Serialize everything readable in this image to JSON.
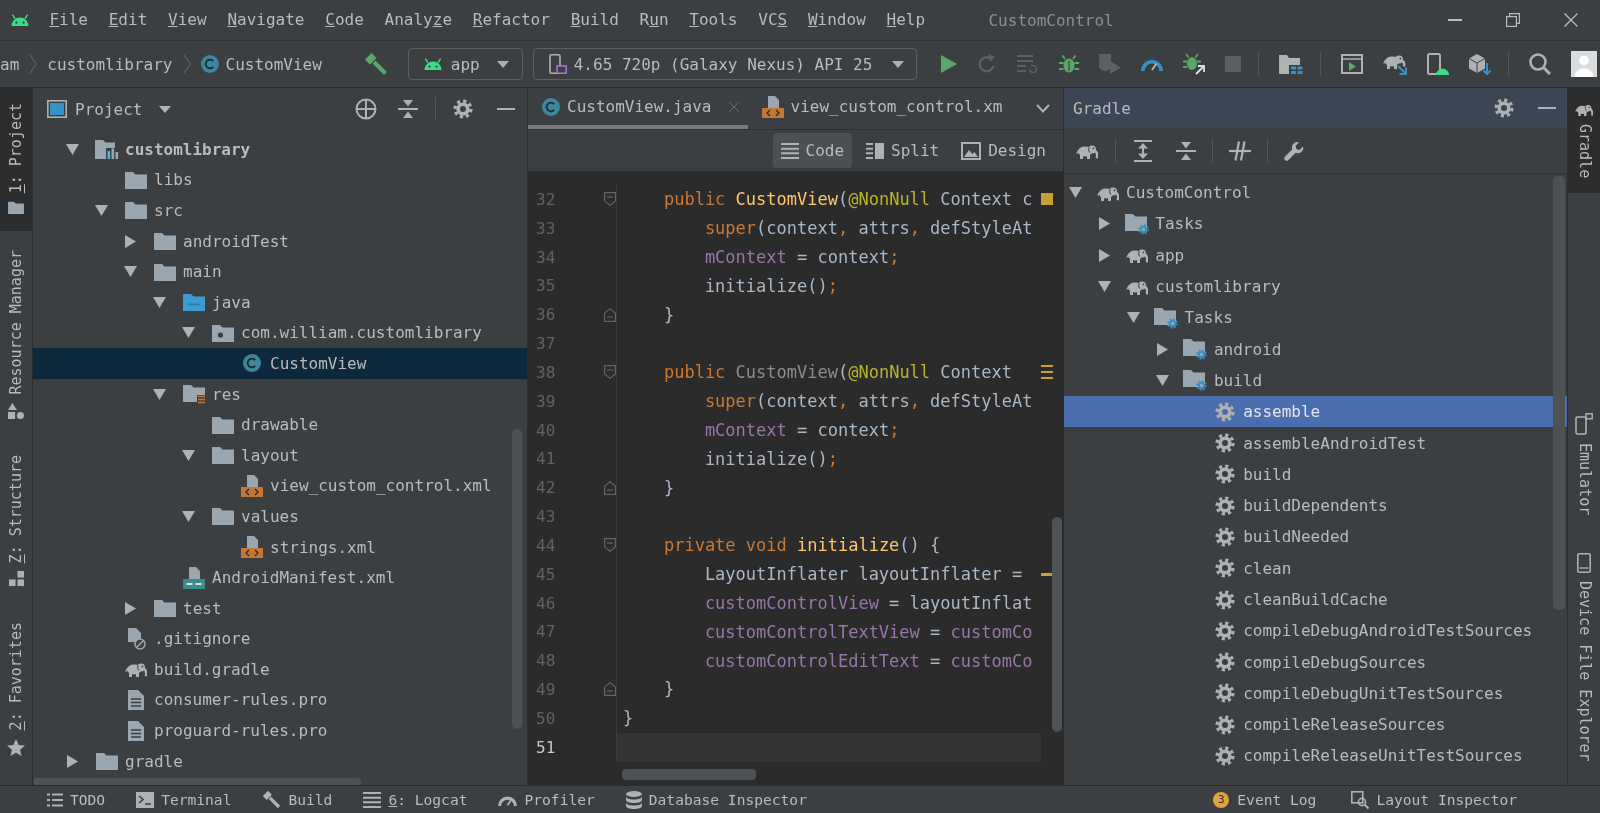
{
  "menu_bar": {
    "items": [
      {
        "mnemonic": "F",
        "post": "ile"
      },
      {
        "mnemonic": "E",
        "post": "dit"
      },
      {
        "mnemonic": "V",
        "post": "iew"
      },
      {
        "mnemonic": "N",
        "post": "avigate"
      },
      {
        "mnemonic": "C",
        "post": "ode"
      },
      {
        "pre": "Analy",
        "mnemonic": "z",
        "post": "e"
      },
      {
        "mnemonic": "R",
        "post": "efactor"
      },
      {
        "mnemonic": "B",
        "post": "uild"
      },
      {
        "pre": "R",
        "mnemonic": "u",
        "post": "n"
      },
      {
        "mnemonic": "T",
        "post": "ools"
      },
      {
        "pre": "VC",
        "mnemonic": "S"
      },
      {
        "mnemonic": "W",
        "post": "indow"
      },
      {
        "mnemonic": "H",
        "post": "elp"
      }
    ],
    "title": "CustomControl"
  },
  "navigation_bar": {
    "breadcrumbs": [
      {
        "label": "am",
        "kind": "plain"
      },
      {
        "label": "customlibrary",
        "kind": "plain"
      },
      {
        "label": "CustomView",
        "kind": "class"
      }
    ],
    "run_configuration": "app",
    "device": "4.65 720p (Galaxy Nexus) API 25",
    "buttons": [
      {
        "disabled": false
      },
      {
        "disabled": false
      },
      {
        "disabled": true
      },
      {
        "disabled": true
      },
      {
        "disabled": false
      },
      {
        "disabled": true
      },
      {
        "disabled": false
      },
      {
        "disabled": false
      },
      {
        "disabled": true
      },
      {
        "disabled": false
      },
      {
        "disabled": false
      },
      {
        "disabled": false
      },
      {
        "disabled": false
      },
      {
        "disabled": false
      },
      {
        "disabled": false
      }
    ]
  },
  "left_tool_strip": [
    {
      "mnemonic": "1",
      "post": ": Project",
      "selected": true
    },
    {
      "label": "Resource Manager",
      "selected": false
    },
    {
      "mnemonic": "Z",
      "post": ": Structure",
      "selected": false
    },
    {
      "mnemonic": "2",
      "post": ": Favorites",
      "selected": false
    }
  ],
  "project_panel": {
    "title": "Project",
    "tree": [
      {
        "label": "customlibrary",
        "kind": "module",
        "expanded": true,
        "selected": false,
        "children": [
          {
            "label": "libs",
            "kind": "folder",
            "selected": false
          },
          {
            "label": "src",
            "kind": "folder",
            "expanded": true,
            "selected": false,
            "children": [
              {
                "label": "androidTest",
                "kind": "folder",
                "expanded": false,
                "selected": false
              },
              {
                "label": "main",
                "kind": "folder",
                "expanded": true,
                "selected": false,
                "children": [
                  {
                    "label": "java",
                    "kind": "source-folder",
                    "expanded": true,
                    "selected": false,
                    "children": [
                      {
                        "label": "com.william.customlibrary",
                        "kind": "package",
                        "expanded": true,
                        "selected": false,
                        "children": [
                          {
                            "label": "CustomView",
                            "kind": "class",
                            "selected": true
                          }
                        ]
                      }
                    ]
                  },
                  {
                    "label": "res",
                    "kind": "resource-folder",
                    "expanded": true,
                    "selected": false,
                    "children": [
                      {
                        "label": "drawable",
                        "kind": "folder",
                        "selected": false
                      },
                      {
                        "label": "layout",
                        "kind": "folder",
                        "expanded": true,
                        "selected": false,
                        "children": [
                          {
                            "label": "view_custom_control.xml",
                            "kind": "xml",
                            "selected": false
                          }
                        ]
                      },
                      {
                        "label": "values",
                        "kind": "folder",
                        "expanded": true,
                        "selected": false,
                        "children": [
                          {
                            "label": "strings.xml",
                            "kind": "xml",
                            "selected": false
                          }
                        ]
                      }
                    ]
                  },
                  {
                    "label": "AndroidManifest.xml",
                    "kind": "manifest",
                    "selected": false
                  }
                ]
              },
              {
                "label": "test",
                "kind": "folder",
                "expanded": false,
                "selected": false
              }
            ]
          },
          {
            "label": ".gitignore",
            "kind": "ignore-file",
            "selected": false
          },
          {
            "label": "build.gradle",
            "kind": "gradle-file",
            "selected": false
          },
          {
            "label": "consumer-rules.pro",
            "kind": "text-file",
            "selected": false
          },
          {
            "label": "proguard-rules.pro",
            "kind": "text-file",
            "selected": false
          }
        ]
      },
      {
        "label": "gradle",
        "kind": "folder",
        "expanded": false,
        "selected": false
      }
    ]
  },
  "editor": {
    "tabs": [
      {
        "label": "CustomView.java",
        "kind": "class",
        "selected": true
      },
      {
        "label": "view_custom_control.xm",
        "kind": "xml",
        "selected": false
      }
    ],
    "view_modes": [
      {
        "label": "Code",
        "selected": true
      },
      {
        "label": "Split",
        "selected": false
      },
      {
        "label": "Design",
        "selected": false
      }
    ],
    "lines": [
      {
        "number": "32",
        "current": false,
        "fold": {
          "kind": "start"
        },
        "marker": {
          "kind": "square"
        },
        "tokens": [
          {
            "text": "    public",
            "kind": "keyword"
          },
          {
            "text": " CustomView",
            "kind": "method"
          },
          {
            "text": "(",
            "kind": "plain"
          },
          {
            "text": "@NonNull",
            "kind": "annotation"
          },
          {
            "text": " Context c",
            "kind": "plain"
          }
        ]
      },
      {
        "number": "33",
        "current": false,
        "tokens": [
          {
            "text": "        super",
            "kind": "keyword"
          },
          {
            "text": "(context",
            "kind": "plain"
          },
          {
            "text": ",",
            "kind": "punctuation"
          },
          {
            "text": " attrs",
            "kind": "plain"
          },
          {
            "text": ",",
            "kind": "punctuation"
          },
          {
            "text": " defStyleAt",
            "kind": "plain"
          }
        ]
      },
      {
        "number": "34",
        "current": false,
        "tokens": [
          {
            "text": "        mContext",
            "kind": "field"
          },
          {
            "text": " = context",
            "kind": "plain"
          },
          {
            "text": ";",
            "kind": "punctuation"
          }
        ]
      },
      {
        "number": "35",
        "current": false,
        "tokens": [
          {
            "text": "        initialize()",
            "kind": "plain"
          },
          {
            "text": ";",
            "kind": "punctuation"
          }
        ]
      },
      {
        "number": "36",
        "current": false,
        "fold": {
          "kind": "end"
        },
        "tokens": [
          {
            "text": "    }",
            "kind": "plain"
          }
        ]
      },
      {
        "number": "37",
        "current": false
      },
      {
        "number": "38",
        "current": false,
        "fold": {
          "kind": "start"
        },
        "marker": {
          "kind": "stack"
        },
        "tokens": [
          {
            "text": "    public",
            "kind": "keyword"
          },
          {
            "text": " CustomView",
            "kind": "unused"
          },
          {
            "text": "(",
            "kind": "plain"
          },
          {
            "text": "@NonNull",
            "kind": "annotation"
          },
          {
            "text": " Context",
            "kind": "plain"
          }
        ]
      },
      {
        "number": "39",
        "current": false,
        "tokens": [
          {
            "text": "        super",
            "kind": "keyword"
          },
          {
            "text": "(context",
            "kind": "plain"
          },
          {
            "text": ",",
            "kind": "punctuation"
          },
          {
            "text": " attrs",
            "kind": "plain"
          },
          {
            "text": ",",
            "kind": "punctuation"
          },
          {
            "text": " defStyleAt",
            "kind": "plain"
          }
        ]
      },
      {
        "number": "40",
        "current": false,
        "tokens": [
          {
            "text": "        mContext",
            "kind": "field"
          },
          {
            "text": " = context",
            "kind": "plain"
          },
          {
            "text": ";",
            "kind": "punctuation"
          }
        ]
      },
      {
        "number": "41",
        "current": false,
        "tokens": [
          {
            "text": "        initialize()",
            "kind": "plain"
          },
          {
            "text": ";",
            "kind": "punctuation"
          }
        ]
      },
      {
        "number": "42",
        "current": false,
        "fold": {
          "kind": "end"
        },
        "tokens": [
          {
            "text": "    }",
            "kind": "plain"
          }
        ]
      },
      {
        "number": "43",
        "current": false
      },
      {
        "number": "44",
        "current": false,
        "fold": {
          "kind": "start"
        },
        "tokens": [
          {
            "text": "    private void",
            "kind": "keyword"
          },
          {
            "text": " initialize",
            "kind": "method"
          },
          {
            "text": "() {",
            "kind": "plain"
          }
        ]
      },
      {
        "number": "45",
        "current": false,
        "marker": {
          "kind": "dash"
        },
        "tokens": [
          {
            "text": "        LayoutInflater layoutInflater =",
            "kind": "plain"
          }
        ]
      },
      {
        "number": "46",
        "current": false,
        "tokens": [
          {
            "text": "        customControlView",
            "kind": "field"
          },
          {
            "text": " = layoutInflat",
            "kind": "plain"
          }
        ]
      },
      {
        "number": "47",
        "current": false,
        "tokens": [
          {
            "text": "        customControlTextView",
            "kind": "field"
          },
          {
            "text": " = ",
            "kind": "plain"
          },
          {
            "text": "customCo",
            "kind": "field"
          }
        ]
      },
      {
        "number": "48",
        "current": false,
        "tokens": [
          {
            "text": "        customControlEditText",
            "kind": "field"
          },
          {
            "text": " = ",
            "kind": "plain"
          },
          {
            "text": "customCo",
            "kind": "field"
          }
        ]
      },
      {
        "number": "49",
        "current": false,
        "fold": {
          "kind": "end"
        },
        "tokens": [
          {
            "text": "    }",
            "kind": "plain"
          }
        ]
      },
      {
        "number": "50",
        "current": false,
        "tokens": [
          {
            "text": "}",
            "kind": "plain"
          }
        ]
      },
      {
        "number": "51",
        "current": true
      }
    ]
  },
  "gradle_panel": {
    "title": "Gradle",
    "tree": [
      {
        "label": "CustomControl",
        "kind": "project",
        "expanded": true,
        "selected": false,
        "children": [
          {
            "label": "Tasks",
            "kind": "task-folder",
            "expanded": false,
            "selected": false
          },
          {
            "label": "app",
            "kind": "project",
            "expanded": false,
            "selected": false
          },
          {
            "label": "customlibrary",
            "kind": "project",
            "expanded": true,
            "selected": false,
            "children": [
              {
                "label": "Tasks",
                "kind": "task-folder",
                "expanded": true,
                "selected": false,
                "children": [
                  {
                    "label": "android",
                    "kind": "task-folder",
                    "expanded": false,
                    "selected": false
                  },
                  {
                    "label": "build",
                    "kind": "task-folder",
                    "expanded": true,
                    "selected": false,
                    "children": [
                      {
                        "label": "assemble",
                        "kind": "task",
                        "selected": true
                      },
                      {
                        "label": "assembleAndroidTest",
                        "kind": "task",
                        "selected": false
                      },
                      {
                        "label": "build",
                        "kind": "task",
                        "selected": false
                      },
                      {
                        "label": "buildDependents",
                        "kind": "task",
                        "selected": false
                      },
                      {
                        "label": "buildNeeded",
                        "kind": "task",
                        "selected": false
                      },
                      {
                        "label": "clean",
                        "kind": "task",
                        "selected": false
                      },
                      {
                        "label": "cleanBuildCache",
                        "kind": "task",
                        "selected": false
                      },
                      {
                        "label": "compileDebugAndroidTestSources",
                        "kind": "task",
                        "selected": false
                      },
                      {
                        "label": "compileDebugSources",
                        "kind": "task",
                        "selected": false
                      },
                      {
                        "label": "compileDebugUnitTestSources",
                        "kind": "task",
                        "selected": false
                      },
                      {
                        "label": "compileReleaseSources",
                        "kind": "task",
                        "selected": false
                      },
                      {
                        "label": "compileReleaseUnitTestSources",
                        "kind": "task",
                        "selected": false
                      }
                    ]
                  }
                ]
              }
            ]
          }
        ]
      }
    ]
  },
  "right_tool_strip": [
    {
      "label": "Gradle",
      "selected": true
    },
    {
      "label": "Emulator",
      "selected": false
    },
    {
      "label": "Device File Explorer",
      "selected": false
    }
  ],
  "status_bar": {
    "tools": [
      {
        "label": "TODO"
      },
      {
        "label": "Terminal"
      },
      {
        "label": "Build"
      },
      {
        "mnemonic": "6",
        "post": ": Logcat"
      },
      {
        "label": "Profiler"
      },
      {
        "label": "Database Inspector"
      }
    ],
    "event_log": {
      "badge": "3",
      "label": "Event Log"
    },
    "layout_inspector": "Layout Inspector"
  }
}
